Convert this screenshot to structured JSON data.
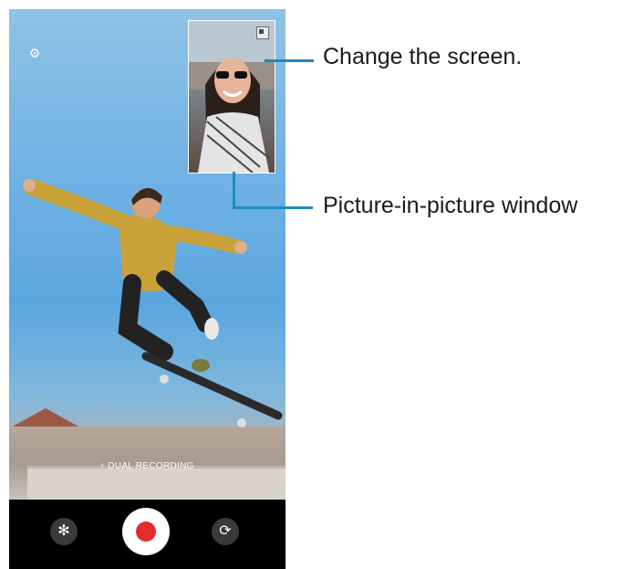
{
  "camera": {
    "mode_label": "DUAL RECORDING",
    "mode_chevron": "‹",
    "settings_icon": "gear-icon",
    "effects_icon": "effects-icon",
    "switch_icon": "switch-camera-icon"
  },
  "callouts": {
    "change_screen": "Change the screen.",
    "pip_window": "Picture-in-picture window"
  },
  "colors": {
    "callout_line": "#1f8bc0",
    "record": "#e52c2c"
  }
}
